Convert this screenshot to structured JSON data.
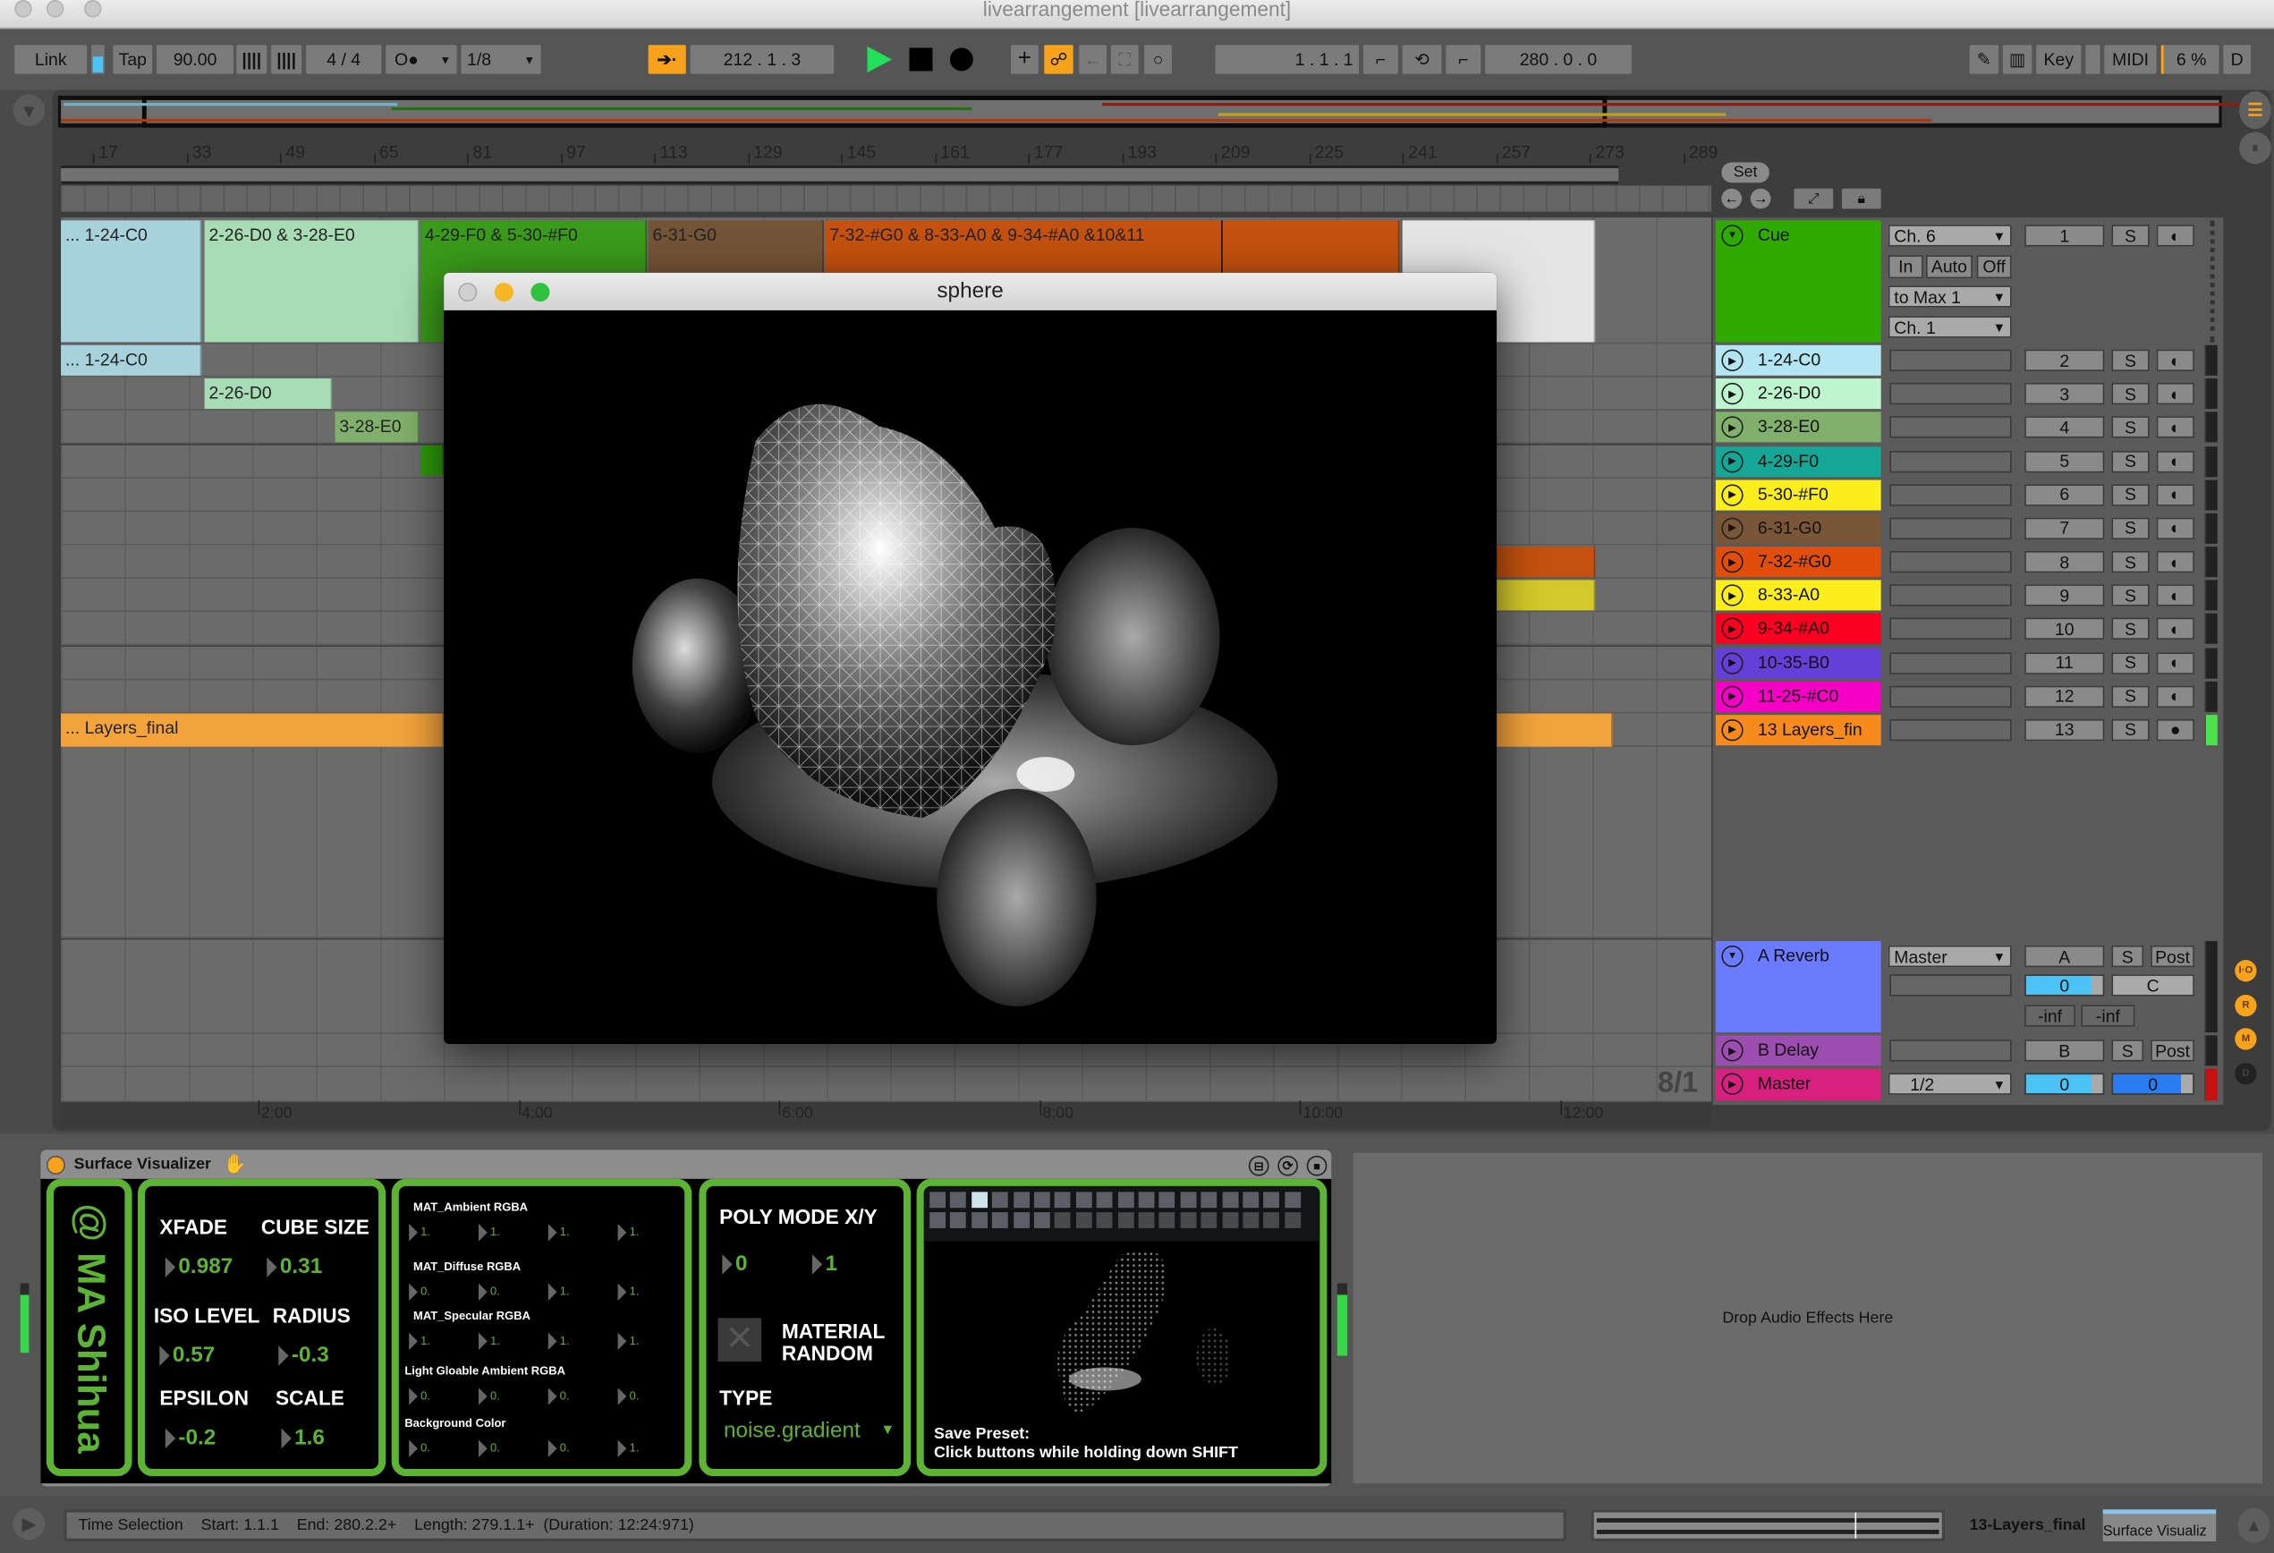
{
  "window": {
    "title": "livearrangement [livearrangement]"
  },
  "toolbar": {
    "link": "Link",
    "tap": "Tap",
    "tempo": "90.00",
    "signature": "4 / 4",
    "metronome": "O●",
    "quantize": "1/8",
    "position": "212 .  1 .  3",
    "loop_start": "1 .  1 .  1",
    "loop_length": "280 .  0 .  0",
    "key": "Key",
    "midi": "MIDI",
    "cpu": "6 %",
    "disk": "D"
  },
  "ruler": {
    "bars": [
      "17",
      "33",
      "49",
      "65",
      "81",
      "97",
      "113",
      "129",
      "145",
      "161",
      "177",
      "193",
      "209",
      "225",
      "241",
      "257",
      "273",
      "289"
    ],
    "times": [
      "2:00",
      "4:00",
      "6:00",
      "8:00",
      "10:00",
      "12:00"
    ]
  },
  "set_button": "Set",
  "clips": {
    "group": [
      "... 1-24-C0",
      "2-26-D0 & 3-28-E0",
      "4-29-F0 & 5-30-#F0",
      "6-31-G0",
      "7-32-#G0 & 8-33-A0 & 9-34-#A0 &10&11"
    ],
    "track1": "... 1-24-C0",
    "track2": "2-26-D0",
    "track3": "3-28-E0",
    "track13": "... Layers_final"
  },
  "cue": {
    "name": "Cue",
    "color": "#2faa00",
    "midi_from": "Ch. 6",
    "monitor": [
      "In",
      "Auto",
      "Off"
    ],
    "midi_to": "to Max 1",
    "midi_to_ch": "Ch. 1",
    "number": "1",
    "solo": "S"
  },
  "tracks": [
    {
      "name": "1-24-C0",
      "color": "#b3e6f2",
      "number": "2"
    },
    {
      "name": "2-26-D0",
      "color": "#bdf5cf",
      "number": "3"
    },
    {
      "name": "3-28-E0",
      "color": "#80b06b",
      "number": "4"
    },
    {
      "name": "4-29-F0",
      "color": "#16a696",
      "number": "5"
    },
    {
      "name": "5-30-#F0",
      "color": "#fcee1c",
      "number": "6"
    },
    {
      "name": "6-31-G0",
      "color": "#7a5638",
      "number": "7"
    },
    {
      "name": "7-32-#G0",
      "color": "#e14e0b",
      "number": "8"
    },
    {
      "name": "8-33-A0",
      "color": "#fcee1c",
      "number": "9"
    },
    {
      "name": "9-34-#A0",
      "color": "#fb0020",
      "number": "10"
    },
    {
      "name": "10-35-B0",
      "color": "#6540d8",
      "number": "11"
    },
    {
      "name": "11-25-#C0",
      "color": "#f500c5",
      "number": "12"
    },
    {
      "name": "13 Layers_fin",
      "color": "#f68a1c",
      "number": "13"
    }
  ],
  "returns": [
    {
      "name": "A Reverb",
      "color": "#6a7bff",
      "output": "Master",
      "send": "A",
      "solo": "S",
      "mode": "Post",
      "volume": "0",
      "pan": "C",
      "peak_l": "-inf",
      "peak_r": "-inf"
    },
    {
      "name": "B Delay",
      "color": "#9c4eb0",
      "send": "B",
      "solo": "S",
      "mode": "Post"
    }
  ],
  "master": {
    "name": "Master",
    "color": "#d8207f",
    "output": "1/2",
    "volume": "0",
    "cue": "0"
  },
  "time_signature_display": "8/1",
  "side_buttons": [
    "I·O",
    "R",
    "M",
    "D"
  ],
  "sphere_window": {
    "title": "sphere"
  },
  "device": {
    "name": "Surface Visualizer",
    "author": "@ MA Shihua",
    "params": [
      {
        "label": "XFADE",
        "value": "0.987"
      },
      {
        "label": "CUBE SIZE",
        "value": "0.31"
      },
      {
        "label": "ISO LEVEL",
        "value": "0.57"
      },
      {
        "label": "RADIUS",
        "value": "-0.3"
      },
      {
        "label": "EPSILON",
        "value": "-0.2"
      },
      {
        "label": "SCALE",
        "value": "1.6"
      }
    ],
    "colors": [
      {
        "label": "MAT_Ambient RGBA",
        "values": [
          "1.",
          "1.",
          "1.",
          "1."
        ]
      },
      {
        "label": "MAT_Diffuse RGBA",
        "values": [
          "0.",
          "0.",
          "1.",
          "1."
        ]
      },
      {
        "label": "MAT_Specular RGBA",
        "values": [
          "1.",
          "1.",
          "1.",
          "1."
        ]
      },
      {
        "label": "Light Gloable Ambient RGBA",
        "values": [
          "0.",
          "0.",
          "0.",
          "0."
        ]
      },
      {
        "label": "Background Color",
        "values": [
          "0.",
          "0.",
          "0.",
          "1."
        ]
      }
    ],
    "poly_mode": {
      "label": "POLY MODE X/Y",
      "x": "0",
      "y": "1"
    },
    "material_random": {
      "label": "MATERIAL RANDOM",
      "checked": false
    },
    "type": {
      "label": "TYPE",
      "value": "noise.gradient"
    },
    "preset_selected": 2,
    "save_preset": {
      "title": "Save Preset:",
      "hint": "Click buttons while holding down SHIFT"
    },
    "accent": "#5db333"
  },
  "drop_effects": "Drop Audio Effects Here",
  "status": {
    "text": "Time Selection    Start: 1.1.1    End: 280.2.2+    Length: 279.1.1+  (Duration: 12:24:971)",
    "track": "13-Layers_final",
    "device": "Surface Visualiz"
  }
}
